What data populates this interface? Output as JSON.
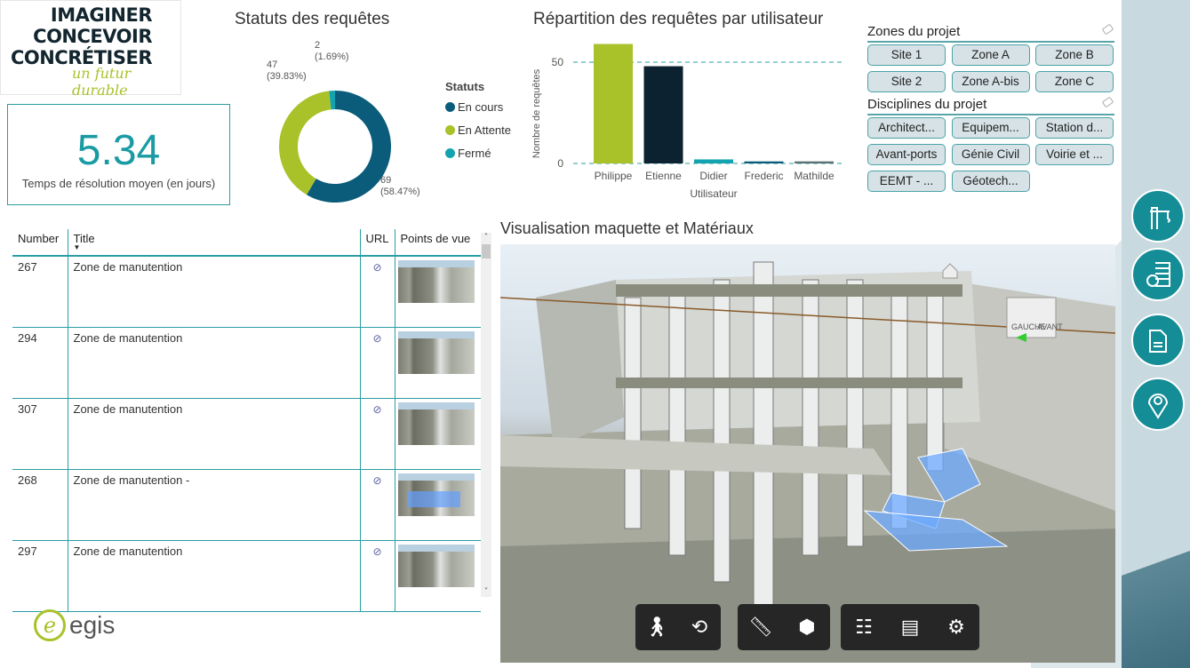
{
  "logo": {
    "lines": [
      "IMAGINER",
      "CONCEVOIR",
      "CONCRÉTISER"
    ],
    "tagline": "un futur durable"
  },
  "kpi": {
    "value": "5.34",
    "caption": "Temps de résolution moyen (en jours)"
  },
  "chart_data": [
    {
      "type": "pie",
      "title": "Statuts des requêtes",
      "legend_title": "Statuts",
      "legend_position": "right",
      "categories": [
        "En cours",
        "En Attente",
        "Fermé"
      ],
      "values": [
        69,
        47,
        2
      ],
      "labels": [
        "69\n(58.47%)",
        "47\n(39.83%)",
        "2\n(1.69%)"
      ],
      "colors": [
        "#0b5c7a",
        "#a9c22a",
        "#13a3b0"
      ]
    },
    {
      "type": "bar",
      "title": "Répartition des requêtes par utilisateur",
      "xlabel": "Utilisateur",
      "ylabel": "Nombre de requêtes",
      "categories": [
        "Philippe",
        "Etienne",
        "Didier",
        "Frederic",
        "Mathilde"
      ],
      "values": [
        59,
        48,
        2,
        1,
        1
      ],
      "colors": [
        "#a9c22a",
        "#0d2230",
        "#13a3b0",
        "#0b5c7a",
        "#5a6e74"
      ],
      "yticks": [
        0,
        50
      ],
      "ylim": [
        0,
        60
      ],
      "grid": true
    }
  ],
  "zones": {
    "title": "Zones du projet",
    "items": [
      "Site 1",
      "Zone A",
      "Zone B",
      "Site 2",
      "Zone A-bis",
      "Zone C"
    ]
  },
  "disciplines": {
    "title": "Disciplines du projet",
    "items": [
      "Architect...",
      "Equipem...",
      "Station d...",
      "Avant-ports",
      "Génie Civil",
      "Voirie et ...",
      "EEMT - ...",
      "Géotech..."
    ]
  },
  "table": {
    "headers": [
      "Number",
      "Title",
      "URL",
      "Points de vue"
    ],
    "rows": [
      {
        "number": "267",
        "title": "Zone de manutention"
      },
      {
        "number": "294",
        "title": "Zone de manutention"
      },
      {
        "number": "307",
        "title": "Zone de manutention"
      },
      {
        "number": "268",
        "title": "Zone de manutention -"
      },
      {
        "number": "297",
        "title": "Zone de manutention"
      }
    ]
  },
  "viewer": {
    "title": "Visualisation maquette et Matériaux",
    "cube_labels": [
      "GAUCHE",
      "AVANT"
    ],
    "toolbar": [
      "person-icon",
      "orbit-icon",
      "ruler-icon",
      "explode-cube-icon",
      "tree-icon",
      "properties-icon",
      "settings-icon"
    ]
  },
  "sidebar_icons": [
    "crane-icon",
    "wall-gear-icon",
    "documents-icon",
    "location-pin-icon"
  ],
  "footer": {
    "brand": "egis"
  }
}
